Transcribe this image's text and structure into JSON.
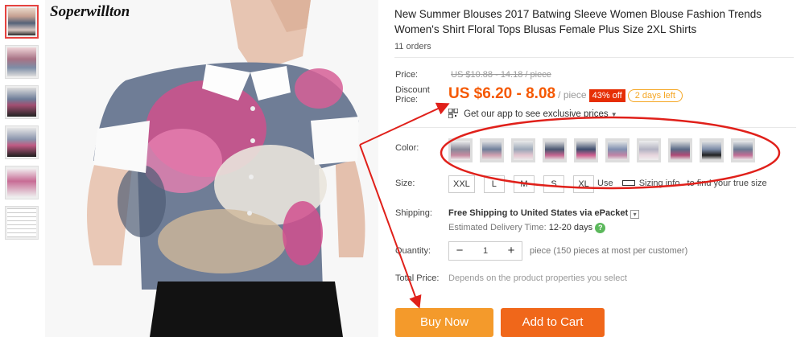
{
  "brand": "Soperwillton",
  "product": {
    "title": "New Summer Blouses 2017 Batwing Sleeve Women Blouse Fashion Trends Women's Shirt Floral Tops Blusas Female Plus Size 2XL Shirts",
    "orders": "11 orders"
  },
  "price": {
    "label": "Price:",
    "original": "US $10.88 - 14.18 / piece",
    "discount_label_1": "Discount",
    "discount_label_2": "Price:",
    "discount": "US $6.20 - 8.08",
    "per": "/ piece",
    "off_badge": "43% off",
    "days_left": "2 days left"
  },
  "app_promo": {
    "label": "Get our app to see exclusive prices",
    "caret": "▼"
  },
  "color": {
    "label": "Color:",
    "swatch_count": 10
  },
  "size": {
    "label": "Size:",
    "options": [
      "XXL",
      "L",
      "M",
      "S",
      "XL"
    ],
    "use_text": "Use",
    "info_link": "Sizing info",
    "suffix": "to find your true size"
  },
  "shipping": {
    "label": "Shipping:",
    "text": "Free Shipping to United States via ePacket",
    "delivery_label": "Estimated Delivery Time:",
    "delivery_time": "12-20 days"
  },
  "quantity": {
    "label": "Quantity:",
    "minus": "−",
    "value": "1",
    "plus": "+",
    "note": "piece (150 pieces at most per customer)"
  },
  "total": {
    "label": "Total Price:",
    "text": "Depends on the product properties you select"
  },
  "buttons": {
    "buy_now": "Buy Now",
    "add_to_cart": "Add to Cart"
  },
  "colors": {
    "accent_orange": "#f55800",
    "badge_red": "#e62e04",
    "annotation_red": "#e0201a"
  }
}
